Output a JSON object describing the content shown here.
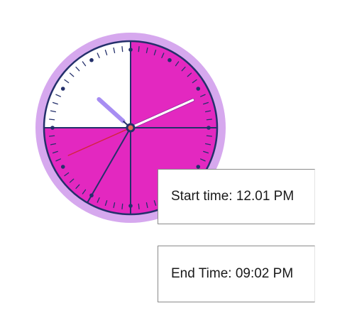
{
  "clock": {
    "colors": {
      "outer_ring": "#d6a8ee",
      "face": "#ffffff",
      "segment_fill": "#e328c0",
      "outline": "#24306b",
      "hour_hand": "#a78df2",
      "minute_hand": "#ffffff",
      "second_hand": "#d4243f",
      "center_dot": "#e8655a"
    },
    "shaded_segments": [
      {
        "from_minute": 0,
        "to_minute": 15
      },
      {
        "from_minute": 15,
        "to_minute": 30
      },
      {
        "from_minute": 30,
        "to_minute": 35
      },
      {
        "from_minute": 35,
        "to_minute": 45
      }
    ],
    "unshaded_segments": [
      {
        "from_minute": 45,
        "to_minute": 60
      }
    ],
    "hands": {
      "hour_minute": 52,
      "minute_minute": 11,
      "second_minute": 41
    }
  },
  "start_time": {
    "label": "Start time: 12.01 PM"
  },
  "end_time": {
    "label": "End Time: 09:02 PM"
  }
}
